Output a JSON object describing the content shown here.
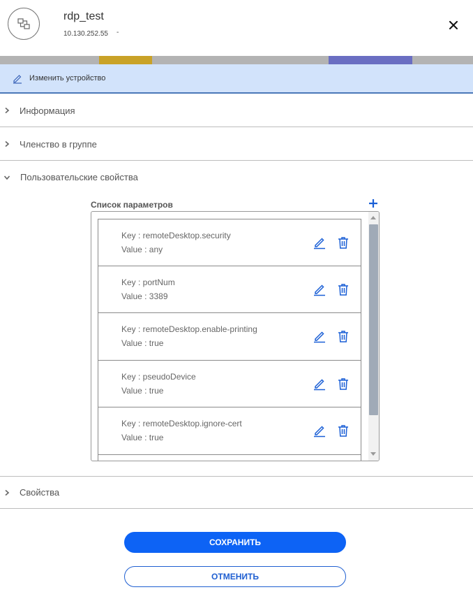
{
  "header": {
    "title": "rdp_test",
    "ip": "10.130.252.55",
    "ip_suffix": "-",
    "device_icon": "network-device-icon",
    "close_icon": "close-icon"
  },
  "edit_bar": {
    "label": "Изменить устройство",
    "icon": "pencil-icon"
  },
  "sections": {
    "info": "Информация",
    "group": "Членство в группе",
    "custom": "Пользовательские свойства",
    "props": "Свойства"
  },
  "params": {
    "label": "Список параметров",
    "add_icon": "plus-icon",
    "items": [
      {
        "key": "Key : remoteDesktop.security",
        "value": "Value : any"
      },
      {
        "key": "Key : portNum",
        "value": "Value : 3389"
      },
      {
        "key": "Key : remoteDesktop.enable-printing",
        "value": "Value : true"
      },
      {
        "key": "Key : pseudoDevice",
        "value": "Value : true"
      },
      {
        "key": "Key : remoteDesktop.ignore-cert",
        "value": "Value : true"
      }
    ]
  },
  "buttons": {
    "save": "СОХРАНИТЬ",
    "cancel": "ОТМЕНИТЬ"
  },
  "colors": {
    "primary": "#0d63f5",
    "icon_blue": "#1a5fd6",
    "edit_bar_bg": "#d2e3fb"
  }
}
